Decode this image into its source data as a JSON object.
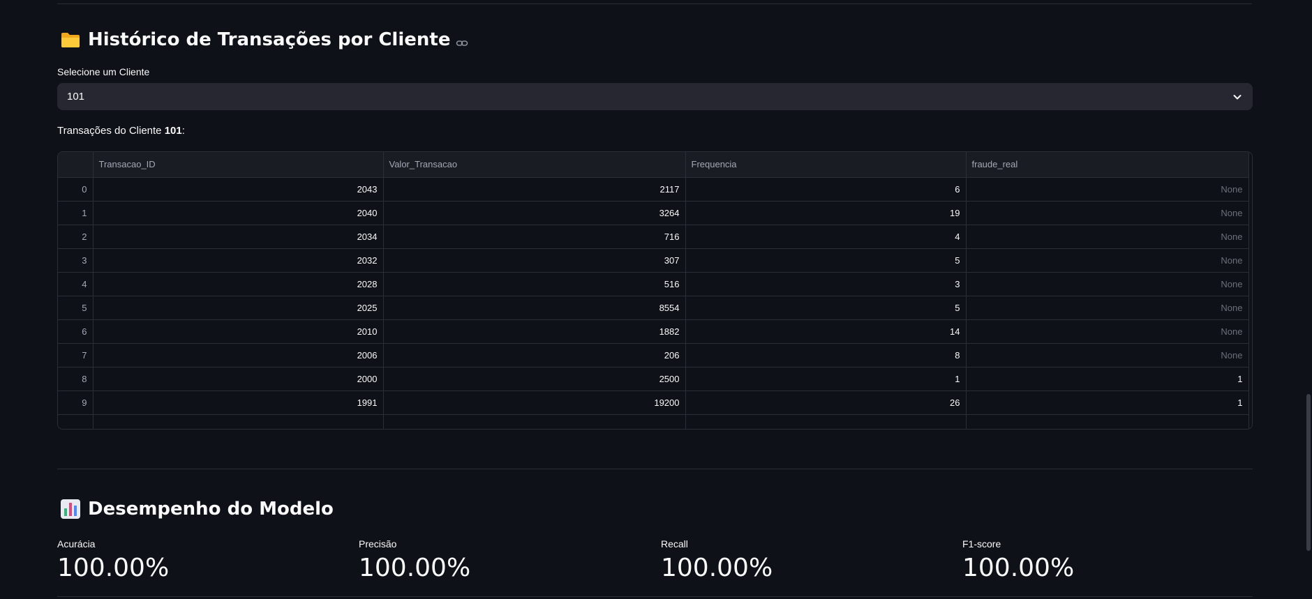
{
  "section1": {
    "title": "Histórico de Transações por Cliente",
    "icon": "folder-icon"
  },
  "select": {
    "label": "Selecione um Cliente",
    "value": "101"
  },
  "caption": {
    "prefix": "Transações do Cliente ",
    "client": "101",
    "suffix": ":"
  },
  "table": {
    "columns": [
      "",
      "Transacao_ID",
      "Valor_Transacao",
      "Frequencia",
      "fraude_real"
    ],
    "rows": [
      [
        "0",
        "2043",
        "2117",
        "6",
        "None"
      ],
      [
        "1",
        "2040",
        "3264",
        "19",
        "None"
      ],
      [
        "2",
        "2034",
        "716",
        "4",
        "None"
      ],
      [
        "3",
        "2032",
        "307",
        "5",
        "None"
      ],
      [
        "4",
        "2028",
        "516",
        "3",
        "None"
      ],
      [
        "5",
        "2025",
        "8554",
        "5",
        "None"
      ],
      [
        "6",
        "2010",
        "1882",
        "14",
        "None"
      ],
      [
        "7",
        "2006",
        "206",
        "8",
        "None"
      ],
      [
        "8",
        "2000",
        "2500",
        "1",
        "1"
      ],
      [
        "9",
        "1991",
        "19200",
        "26",
        "1"
      ]
    ]
  },
  "section2": {
    "title": "Desempenho do Modelo",
    "icon": "bar-chart-icon"
  },
  "metrics": [
    {
      "label": "Acurácia",
      "value": "100.00%"
    },
    {
      "label": "Precisão",
      "value": "100.00%"
    },
    {
      "label": "Recall",
      "value": "100.00%"
    },
    {
      "label": "F1-score",
      "value": "100.00%"
    }
  ],
  "colors": {
    "background": "#0e1117",
    "select_bg": "#262730",
    "border": "#2b2e37",
    "muted": "#a3a8b4"
  }
}
